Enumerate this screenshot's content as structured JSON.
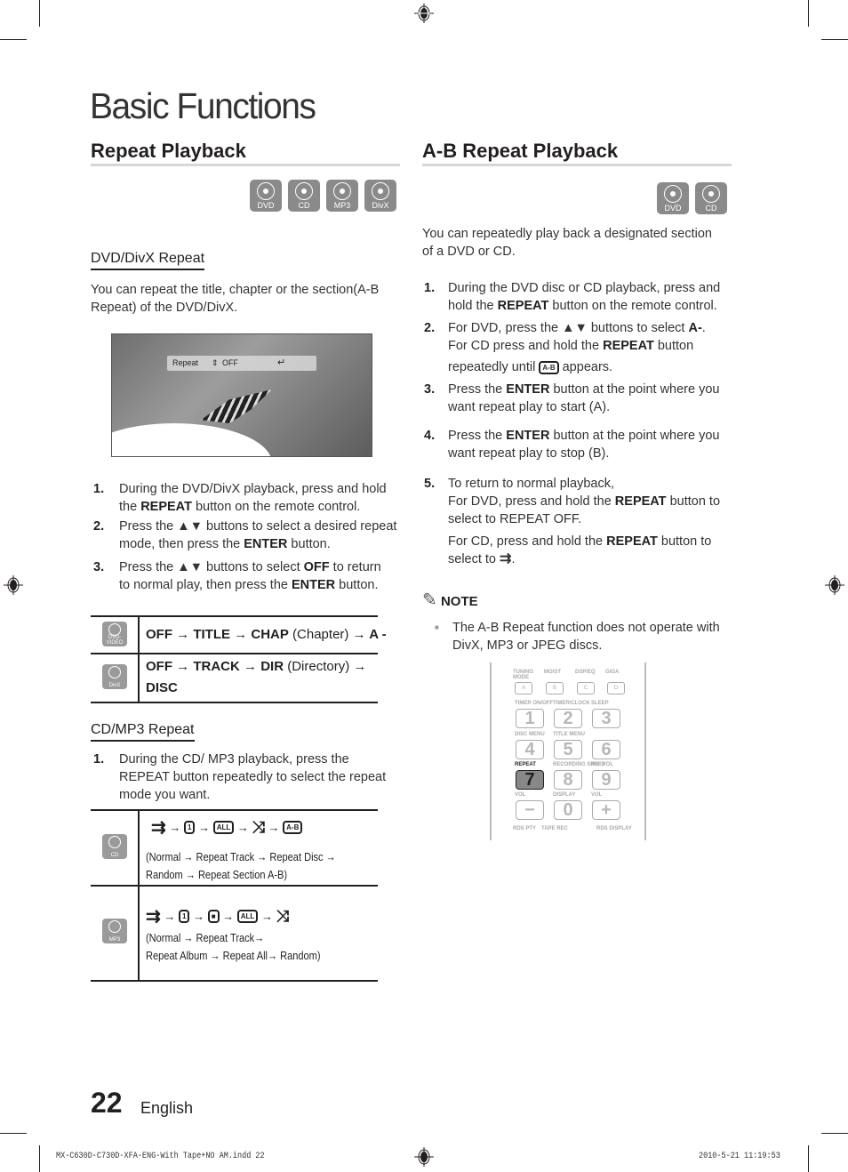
{
  "page": {
    "title": "Basic Functions",
    "page_number": "22",
    "language": "English",
    "slug_file": "MX-C630D-C730D-XFA-ENG-With Tape+NO AM.indd   22",
    "slug_date": "2010-5-21   11:19:53"
  },
  "left": {
    "section_title": "Repeat Playback",
    "disc_icons": [
      {
        "icon": "disc-icon",
        "label": "DVD"
      },
      {
        "icon": "disc-icon",
        "label": "CD"
      },
      {
        "icon": "disc-icon",
        "label": "MP3"
      },
      {
        "icon": "disc-icon",
        "label": "DivX"
      }
    ],
    "dvd_divx": {
      "subtitle": "DVD/DivX Repeat",
      "intro_1": "You can repeat the title, chapter or the section(A-B",
      "intro_2": "Repeat) of the DVD/DivX.",
      "osd": {
        "label": "Repeat",
        "arrows": "⇕",
        "value": "OFF",
        "enter_icon": "↵"
      },
      "steps": [
        {
          "num": "1.",
          "l1": "During the DVD/DivX playback, press and hold",
          "l2a": "the ",
          "l2b": "REPEAT",
          "l2c": " button on the remote control."
        },
        {
          "num": "2.",
          "l1": "Press the ▲▼ buttons to select a desired repeat",
          "l2a": "mode, then press the ",
          "l2b": "ENTER",
          "l2c": " button."
        },
        {
          "num": "3.",
          "l1a": "Press the ▲▼ buttons to select ",
          "l1b": "OFF",
          "l1c": " to return",
          "l2a": "to normal play, then press the ",
          "l2b": "ENTER",
          "l2c": " button."
        }
      ],
      "table": [
        {
          "disc_label": "DVD-VIDEO",
          "line1": [
            [
              "OFF",
              "b"
            ],
            [
              " → ",
              "b"
            ],
            [
              "TITLE",
              "b"
            ],
            [
              " → ",
              "b"
            ],
            [
              "CHAP",
              "b"
            ],
            [
              " (Chapter) ",
              "n"
            ],
            [
              "→ A -",
              "b"
            ]
          ]
        },
        {
          "disc_label": "DivX",
          "line1": [
            [
              "OFF",
              "b"
            ],
            [
              " → ",
              "b"
            ],
            [
              "TRACK",
              "b"
            ],
            [
              " → ",
              "b"
            ],
            [
              "DIR",
              "b"
            ],
            [
              " (Directory) ",
              "n"
            ],
            [
              "→",
              "b"
            ]
          ],
          "line2": "DISC"
        }
      ]
    },
    "cd_mp3": {
      "subtitle": "CD/MP3 Repeat",
      "step": {
        "num": "1.",
        "l1": "During the CD/ MP3 playback, press the",
        "l2": "REPEAT button repeatedly to select the repeat",
        "l3": "mode you want."
      },
      "table": [
        {
          "disc_label": "CD",
          "icons": [
            "normal-play-icon",
            "repeat-track-icon",
            "repeat-disc-icon",
            "random-icon",
            "repeat-ab-icon"
          ],
          "desc_1": "(Normal → Repeat Track → Repeat Disc →",
          "desc_2": "Random → Repeat Section A-B)"
        },
        {
          "disc_label": "MP3",
          "icons": [
            "normal-play-icon",
            "repeat-track-icon",
            "repeat-album-icon",
            "repeat-all-icon",
            "random-icon"
          ],
          "desc_1": "(Normal  → Repeat Track→",
          "desc_2": "Repeat Album → Repeat All→ Random)"
        }
      ],
      "arrow": "→",
      "icon_text": {
        "one": "1",
        "all": "ALL",
        "ab": "A-B"
      }
    }
  },
  "right": {
    "section_title": "A-B Repeat Playback",
    "disc_icons": [
      {
        "icon": "disc-icon",
        "label": "DVD"
      },
      {
        "icon": "disc-icon",
        "label": "CD"
      }
    ],
    "intro_1": "You can repeatedly play back a designated section",
    "intro_2": "of a DVD or CD.",
    "steps": {
      "s1": {
        "num": "1.",
        "l1": "During the DVD disc or CD playback, press and",
        "l2a": "hold the ",
        "l2b": "REPEAT",
        "l2c": " button on the remote control."
      },
      "s2": {
        "num": "2.",
        "l1a": "For DVD, press the ▲▼ buttons to select ",
        "l1b": "A-",
        "l1c": ".",
        "l2a": "For CD press and hold the ",
        "l2b": "REPEAT",
        "l2c": " button",
        "l3a": "repeatedly until ",
        "l3icon": "A-B",
        "l3c": " appears."
      },
      "s3": {
        "num": "3.",
        "l1a": "Press the ",
        "l1b": "ENTER",
        "l1c": " button at the point where you",
        "l2": "want repeat play to start (A)."
      },
      "s4": {
        "num": "4.",
        "l1a": "Press the ",
        "l1b": "ENTER",
        "l1c": " button at the point where you",
        "l2": "want repeat play to stop (B)."
      },
      "s5": {
        "num": "5.",
        "l1": "To return to normal playback,",
        "l2a": "For DVD, press and hold the ",
        "l2b": "REPEAT",
        "l2c": " button to",
        "l3": "select to REPEAT OFF.",
        "l4a": "For CD, press and hold the ",
        "l4b": "REPEAT",
        "l4c": " button to",
        "l5": "select to "
      }
    },
    "note": {
      "title": "NOTE",
      "bullet": "■",
      "l1": "The A-B Repeat function does not operate with",
      "l2": "DivX, MP3 or JPEG discs."
    },
    "remote": {
      "row_ab_labels": [
        "TUNING\nMODE",
        "MO/ST",
        "DSP/EQ",
        "GIGA"
      ],
      "row_ab_keys": [
        "A",
        "B",
        "C",
        "D"
      ],
      "row1_labels": [
        "TIMER ON/OFF",
        "TIMER/CLOCK",
        "SLEEP"
      ],
      "row1_keys": [
        "1",
        "2",
        "3"
      ],
      "row2_labels": [
        "DISC MENU",
        "TITLE MENU",
        ""
      ],
      "row2_keys": [
        "4",
        "5",
        "6"
      ],
      "row3_labels": [
        "REPEAT",
        "RECORDING SPEED",
        "MIC VOL"
      ],
      "row3_keys": [
        "7",
        "8",
        "9"
      ],
      "row4_labels": [
        "VOL",
        "DISPLAY",
        "VOL"
      ],
      "row4_keys": [
        "−",
        "0",
        "+"
      ],
      "row5_labels": [
        "RDS PTY",
        "TAPE REC",
        "RDS DISPLAY"
      ],
      "highlighted_key": "7"
    }
  }
}
